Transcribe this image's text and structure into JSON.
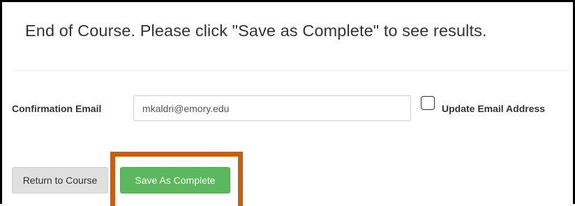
{
  "header": {
    "title": "End of Course. Please click \"Save as Complete\" to see results."
  },
  "confirmation": {
    "label": "Confirmation Email",
    "email_value": "mkaldri@emory.edu",
    "update_checkbox_checked": false,
    "update_label": "Update Email Address"
  },
  "actions": {
    "return_label": "Return to Course",
    "save_label": "Save As Complete"
  },
  "colors": {
    "save_button": "#5cb85c",
    "highlight_border": "#c65f12",
    "return_button": "#e0e0e0"
  }
}
